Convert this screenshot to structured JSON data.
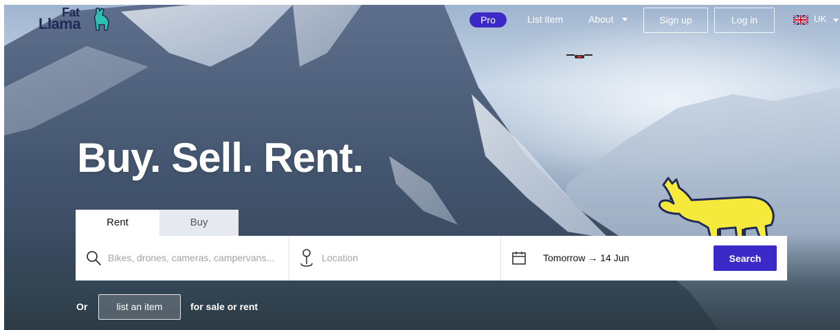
{
  "brand": {
    "name_top": "Fat",
    "name_bottom": "Llama",
    "logo_icon": "llama-logo-icon",
    "navy": "#1f2a55",
    "teal": "#2bc2b0"
  },
  "header": {
    "pro_label": "Pro",
    "list_item_label": "List item",
    "about_label": "About",
    "signup_label": "Sign up",
    "login_label": "Log in",
    "country_label": "UK",
    "accent": "#3b29c8"
  },
  "hero": {
    "headline": "Buy. Sell. Rent."
  },
  "search": {
    "tabs": [
      {
        "label": "Rent",
        "active": true
      },
      {
        "label": "Buy",
        "active": false
      }
    ],
    "query_placeholder": "Bikes, drones, cameras, campervans...",
    "location_placeholder": "Location",
    "dates": "Tomorrow → 14 Jun",
    "button_label": "Search"
  },
  "footer_cta": {
    "prefix": "Or",
    "button_label": "list an item",
    "suffix": "for sale or rent"
  }
}
